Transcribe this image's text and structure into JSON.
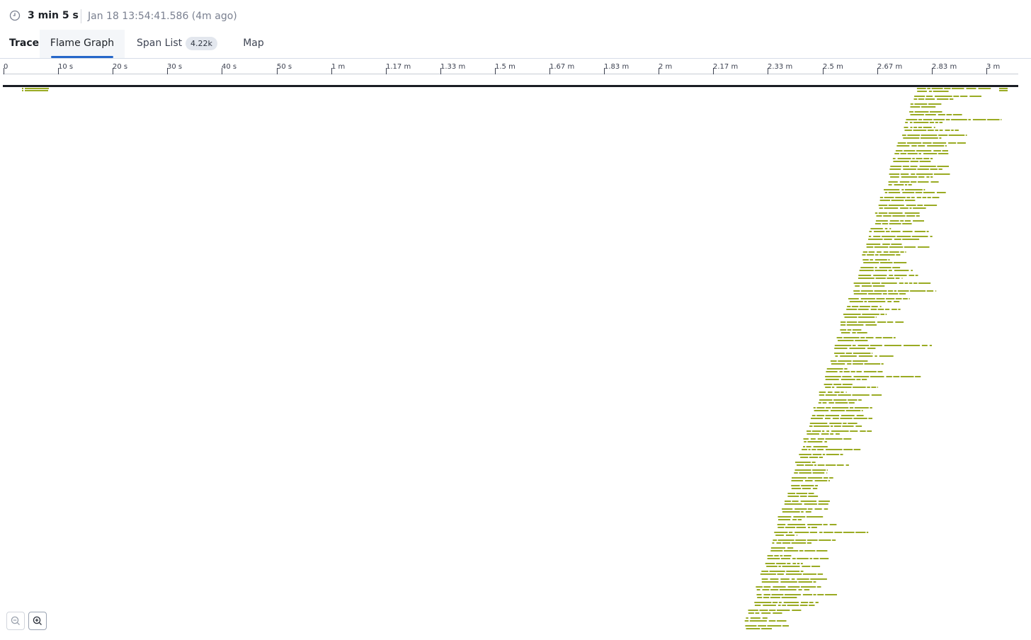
{
  "header": {
    "duration": "3 min 5 s",
    "timestamp": "Jan 18 13:54:41.586 (4m ago)"
  },
  "tabs": {
    "trace_label": "Trace:",
    "items": [
      {
        "label": "Flame Graph",
        "active": true
      },
      {
        "label": "Span List",
        "badge": "4.22k"
      },
      {
        "label": "Map"
      }
    ]
  },
  "ruler": {
    "ticks": [
      "0",
      "10 s",
      "20 s",
      "30 s",
      "40 s",
      "50 s",
      "1 m",
      "1.17 m",
      "1.33 m",
      "1.5 m",
      "1.67 m",
      "1.83 m",
      "2 m",
      "2.17 m",
      "2.33 m",
      "2.5 m",
      "2.67 m",
      "2.83 m",
      "3 m"
    ]
  },
  "colors": {
    "span": "#9aab23",
    "root": "#1a1d24",
    "accent": "#2667c9"
  },
  "icons": {
    "clock": "clock-icon",
    "zoom_out": "zoom-out-icon",
    "zoom_in": "zoom-in-icon"
  }
}
